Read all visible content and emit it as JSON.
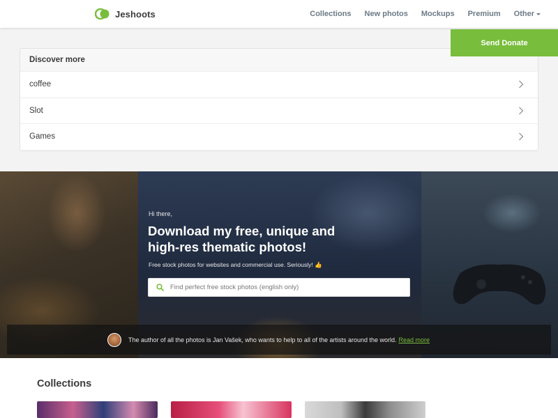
{
  "header": {
    "brand": "Jeshoots",
    "nav": [
      {
        "label": "Collections"
      },
      {
        "label": "New photos"
      },
      {
        "label": "Mockups"
      },
      {
        "label": "Premium"
      },
      {
        "label": "Other"
      }
    ]
  },
  "donate": {
    "label": "Send Donate"
  },
  "discover": {
    "title": "Discover more",
    "items": [
      {
        "label": "coffee"
      },
      {
        "label": "Slot"
      },
      {
        "label": "Games"
      }
    ]
  },
  "hero": {
    "greeting": "Hi there,",
    "title_line1": "Download my free, unique and",
    "title_line2": "high-res thematic photos!",
    "subtitle": "Free stock photos for websites and commercial use. Seriously! 👍",
    "search_placeholder": "Find perfect free stock photos (english only)",
    "author_text": "The author of all the photos is Jan Vašek, who wants to help to all of the artists around the world.",
    "author_link": "Read more"
  },
  "collections": {
    "title": "Collections"
  },
  "colors": {
    "accent": "#79bd3c",
    "nav_text": "#6c7a86"
  },
  "icons": [
    "logo-icon",
    "chevron-right-icon",
    "search-icon",
    "caret-down-icon"
  ]
}
